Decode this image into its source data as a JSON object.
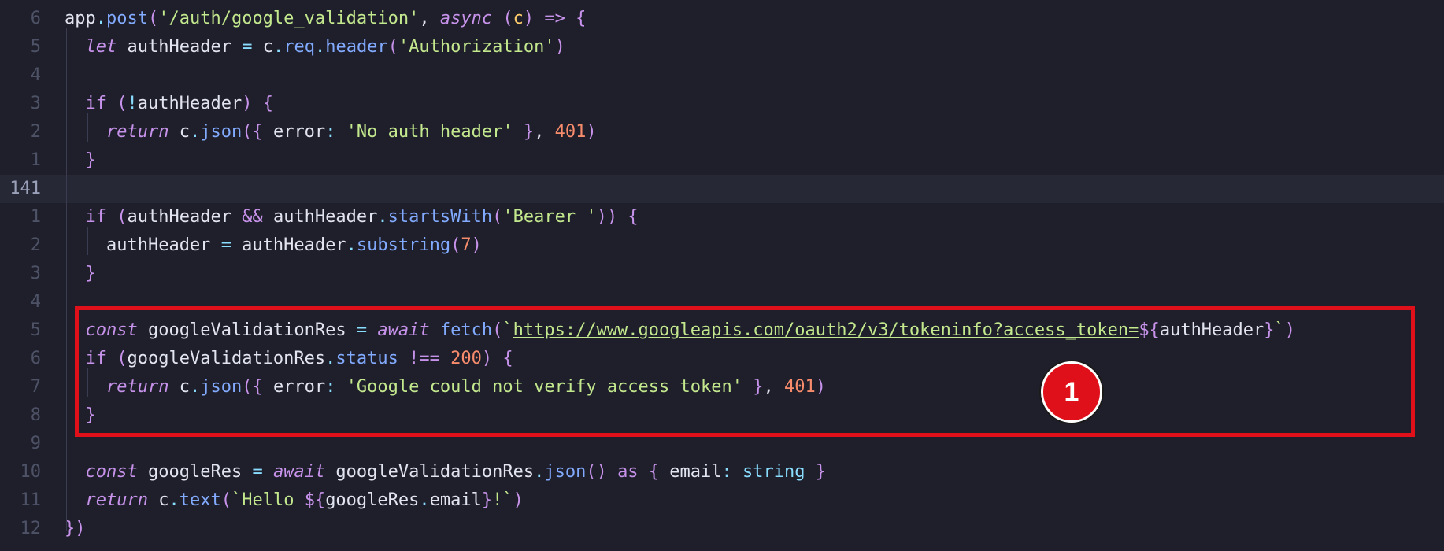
{
  "editor": {
    "line_numbers": [
      "6",
      "5",
      "4",
      "3",
      "2",
      "1",
      "141",
      "1",
      "2",
      "3",
      "4",
      "5",
      "6",
      "7",
      "8",
      "9",
      "10",
      "11",
      "12"
    ],
    "lines": [
      [
        [
          "pl",
          "app"
        ],
        [
          "pn",
          "."
        ],
        [
          "fn",
          "post"
        ],
        [
          "pv",
          "("
        ],
        [
          "st",
          "'/auth/google_validation'"
        ],
        [
          "pl",
          ", "
        ],
        [
          "kwi",
          "async"
        ],
        [
          "pl",
          " "
        ],
        [
          "pv",
          "("
        ],
        [
          "pa",
          "c"
        ],
        [
          "pv",
          ")"
        ],
        [
          "pl",
          " "
        ],
        [
          "kw",
          "=>"
        ],
        [
          "pl",
          " "
        ],
        [
          "pv",
          "{"
        ]
      ],
      [
        [
          "pl",
          "  "
        ],
        [
          "kwi",
          "let"
        ],
        [
          "pl",
          " authHeader "
        ],
        [
          "pn",
          "="
        ],
        [
          "pl",
          " c"
        ],
        [
          "pn",
          "."
        ],
        [
          "pr",
          "req"
        ],
        [
          "pn",
          "."
        ],
        [
          "fn",
          "header"
        ],
        [
          "pv",
          "("
        ],
        [
          "st",
          "'Authorization'"
        ],
        [
          "pv",
          ")"
        ]
      ],
      [],
      [
        [
          "pl",
          "  "
        ],
        [
          "kw",
          "if"
        ],
        [
          "pl",
          " "
        ],
        [
          "pv",
          "("
        ],
        [
          "pn",
          "!"
        ],
        [
          "pl",
          "authHeader"
        ],
        [
          "pv",
          ")"
        ],
        [
          "pl",
          " "
        ],
        [
          "pv",
          "{"
        ]
      ],
      [
        [
          "pl",
          "    "
        ],
        [
          "kwi",
          "return"
        ],
        [
          "pl",
          " c"
        ],
        [
          "pn",
          "."
        ],
        [
          "fn",
          "json"
        ],
        [
          "pv",
          "({"
        ],
        [
          "pl",
          " error"
        ],
        [
          "pn",
          ":"
        ],
        [
          "pl",
          " "
        ],
        [
          "st",
          "'No auth header'"
        ],
        [
          "pl",
          " "
        ],
        [
          "pv",
          "}"
        ],
        [
          "pl",
          ", "
        ],
        [
          "nu",
          "401"
        ],
        [
          "pv",
          ")"
        ]
      ],
      [
        [
          "pl",
          "  "
        ],
        [
          "pv",
          "}"
        ]
      ],
      [],
      [
        [
          "pl",
          "  "
        ],
        [
          "kw",
          "if"
        ],
        [
          "pl",
          " "
        ],
        [
          "pv",
          "("
        ],
        [
          "pl",
          "authHeader "
        ],
        [
          "kw",
          "&&"
        ],
        [
          "pl",
          " authHeader"
        ],
        [
          "pn",
          "."
        ],
        [
          "fn",
          "startsWith"
        ],
        [
          "pv",
          "("
        ],
        [
          "st",
          "'Bearer '"
        ],
        [
          "pv",
          "))"
        ],
        [
          "pl",
          " "
        ],
        [
          "pv",
          "{"
        ]
      ],
      [
        [
          "pl",
          "    authHeader "
        ],
        [
          "pn",
          "="
        ],
        [
          "pl",
          " authHeader"
        ],
        [
          "pn",
          "."
        ],
        [
          "fn",
          "substring"
        ],
        [
          "pv",
          "("
        ],
        [
          "nu",
          "7"
        ],
        [
          "pv",
          ")"
        ]
      ],
      [
        [
          "pl",
          "  "
        ],
        [
          "pv",
          "}"
        ]
      ],
      [],
      [
        [
          "pl",
          "  "
        ],
        [
          "kwi",
          "const"
        ],
        [
          "pl",
          " googleValidationRes "
        ],
        [
          "pn",
          "="
        ],
        [
          "pl",
          " "
        ],
        [
          "kwi",
          "await"
        ],
        [
          "pl",
          " "
        ],
        [
          "fn",
          "fetch"
        ],
        [
          "pv",
          "("
        ],
        [
          "st",
          "`"
        ],
        [
          "url",
          "https://www.googleapis.com/oauth2/v3/tokeninfo?access_token="
        ],
        [
          "kw",
          "${"
        ],
        [
          "pl",
          "authHeader"
        ],
        [
          "kw",
          "}"
        ],
        [
          "st",
          "`"
        ],
        [
          "pv",
          ")"
        ]
      ],
      [
        [
          "pl",
          "  "
        ],
        [
          "kw",
          "if"
        ],
        [
          "pl",
          " "
        ],
        [
          "pv",
          "("
        ],
        [
          "pl",
          "googleValidationRes"
        ],
        [
          "pn",
          "."
        ],
        [
          "pr",
          "status"
        ],
        [
          "pl",
          " "
        ],
        [
          "kw",
          "!=="
        ],
        [
          "pl",
          " "
        ],
        [
          "nu",
          "200"
        ],
        [
          "pv",
          ")"
        ],
        [
          "pl",
          " "
        ],
        [
          "pv",
          "{"
        ]
      ],
      [
        [
          "pl",
          "    "
        ],
        [
          "kwi",
          "return"
        ],
        [
          "pl",
          " c"
        ],
        [
          "pn",
          "."
        ],
        [
          "fn",
          "json"
        ],
        [
          "pv",
          "({"
        ],
        [
          "pl",
          " error"
        ],
        [
          "pn",
          ":"
        ],
        [
          "pl",
          " "
        ],
        [
          "st",
          "'Google could not verify access token'"
        ],
        [
          "pl",
          " "
        ],
        [
          "pv",
          "}"
        ],
        [
          "pl",
          ", "
        ],
        [
          "nu",
          "401"
        ],
        [
          "pv",
          ")"
        ]
      ],
      [
        [
          "pl",
          "  "
        ],
        [
          "pv",
          "}"
        ]
      ],
      [],
      [
        [
          "pl",
          "  "
        ],
        [
          "kwi",
          "const"
        ],
        [
          "pl",
          " googleRes "
        ],
        [
          "pn",
          "="
        ],
        [
          "pl",
          " "
        ],
        [
          "kwi",
          "await"
        ],
        [
          "pl",
          " googleValidationRes"
        ],
        [
          "pn",
          "."
        ],
        [
          "fn",
          "json"
        ],
        [
          "pv",
          "()"
        ],
        [
          "pl",
          " "
        ],
        [
          "kw",
          "as"
        ],
        [
          "pl",
          " "
        ],
        [
          "pv",
          "{"
        ],
        [
          "pl",
          " email"
        ],
        [
          "pn",
          ":"
        ],
        [
          "pl",
          " "
        ],
        [
          "ty",
          "string"
        ],
        [
          "pl",
          " "
        ],
        [
          "pv",
          "}"
        ]
      ],
      [
        [
          "pl",
          "  "
        ],
        [
          "kwi",
          "return"
        ],
        [
          "pl",
          " c"
        ],
        [
          "pn",
          "."
        ],
        [
          "fn",
          "text"
        ],
        [
          "pv",
          "("
        ],
        [
          "st",
          "`Hello "
        ],
        [
          "kw",
          "${"
        ],
        [
          "pl",
          "googleRes"
        ],
        [
          "pn",
          "."
        ],
        [
          "pl",
          "email"
        ],
        [
          "kw",
          "}"
        ],
        [
          "st",
          "!`"
        ],
        [
          "pv",
          ")"
        ]
      ],
      [
        [
          "pv",
          "})"
        ]
      ]
    ],
    "current_line_index": 6
  },
  "annotation": {
    "badge_label": "1",
    "box_color": "#e0101a"
  }
}
